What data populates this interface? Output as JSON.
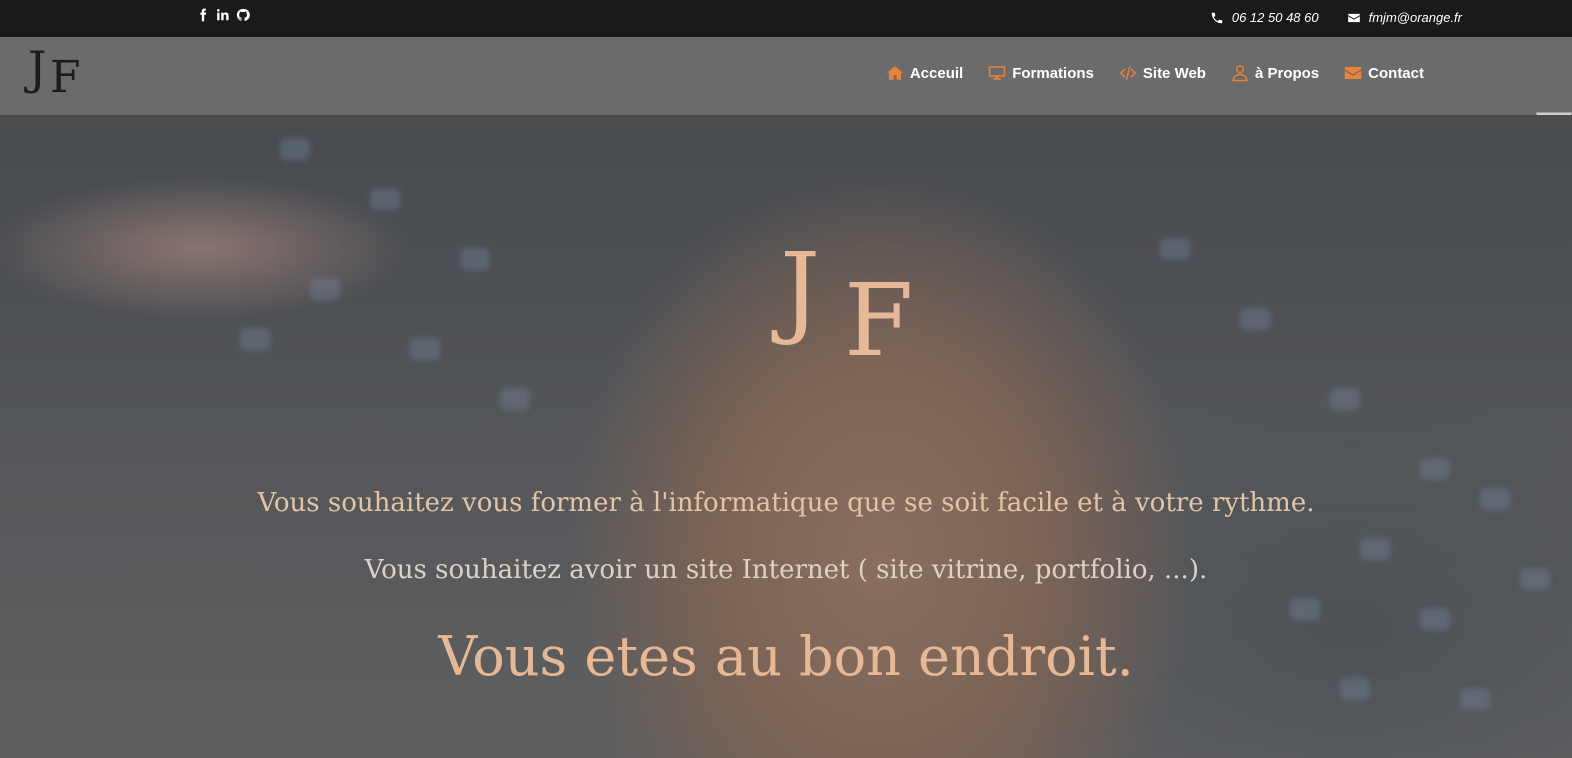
{
  "topbar": {
    "social": [
      "facebook-icon",
      "linkedin-icon",
      "github-icon"
    ],
    "phone": "06 12 50 48 60",
    "email": "fmjm@orange.fr"
  },
  "logo": {
    "j": "J",
    "f": "F"
  },
  "nav": [
    {
      "label": "Acceuil",
      "icon": "home-icon"
    },
    {
      "label": "Formations",
      "icon": "desktop-icon"
    },
    {
      "label": "Site Web",
      "icon": "code-icon"
    },
    {
      "label": "à Propos",
      "icon": "user-icon"
    },
    {
      "label": "Contact",
      "icon": "envelope-icon"
    }
  ],
  "hero": {
    "logo_j": "J",
    "logo_f": "F",
    "line1": "Vous souhaitez vous former à l'informatique que se soit facile et à votre rythme.",
    "line2": "Vous souhaitez avoir un site Internet ( site vitrine, portfolio, ...).",
    "line3": "Vous etes au bon endroit."
  },
  "colors": {
    "accent": "#e9833a",
    "hero_text": "#e6b896",
    "topbar_bg": "#1a1a1a",
    "navbar_bg": "#6b6b6b"
  }
}
